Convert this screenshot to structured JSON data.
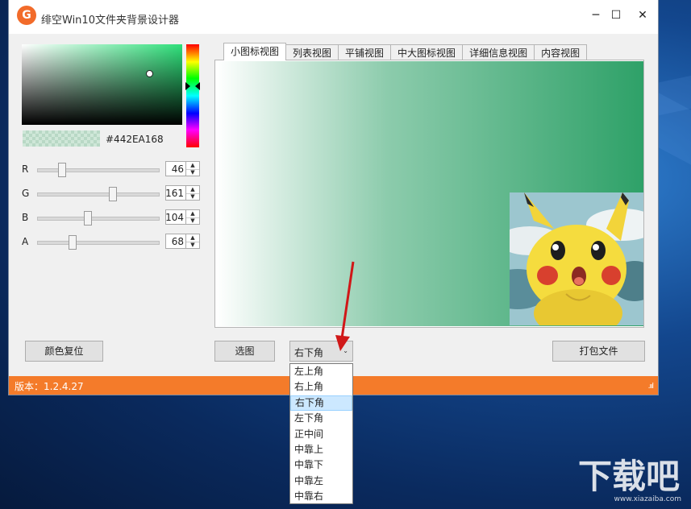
{
  "window": {
    "title": "绯空Win10文件夹背景设计器",
    "logo_letter": "G",
    "min_glyph": "─",
    "max_glyph": "☐",
    "close_glyph": "✕"
  },
  "colors": {
    "accent_orange": "#f47b2a",
    "selected_color": "#442EA168"
  },
  "picker": {
    "hex": "#442EA168",
    "channels": [
      {
        "label": "R",
        "value": "46",
        "fraction": 0.18
      },
      {
        "label": "G",
        "value": "161",
        "fraction": 0.63
      },
      {
        "label": "B",
        "value": "104",
        "fraction": 0.41
      },
      {
        "label": "A",
        "value": "68",
        "fraction": 0.27
      }
    ],
    "reset_label": "颜色复位"
  },
  "tabs": [
    {
      "label": "小图标视图",
      "active": true
    },
    {
      "label": "列表视图",
      "active": false
    },
    {
      "label": "平铺视图",
      "active": false
    },
    {
      "label": "中大图标视图",
      "active": false
    },
    {
      "label": "详细信息视图",
      "active": false
    },
    {
      "label": "内容视图",
      "active": false
    }
  ],
  "actions": {
    "choose_image_label": "选图",
    "package_label": "打包文件"
  },
  "position_select": {
    "value": "右下角",
    "options": [
      "左上角",
      "右上角",
      "右下角",
      "左下角",
      "正中间",
      "中靠上",
      "中靠下",
      "中靠左",
      "中靠右"
    ],
    "selected": "右下角"
  },
  "status": {
    "version": "版本：1.2.4.27",
    "grip": ".ııl"
  },
  "watermark": {
    "text": "下载吧",
    "sub": "www.xiazaiba.com"
  }
}
